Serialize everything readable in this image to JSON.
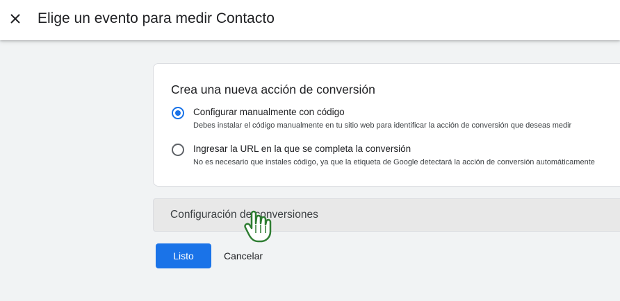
{
  "header": {
    "title": "Elige un evento para medir Contacto",
    "close_icon": "close-icon"
  },
  "card": {
    "title": "Crea una nueva acción de conversión",
    "options": [
      {
        "label": "Configurar manualmente con código",
        "description": "Debes instalar el código manualmente en tu sitio web para identificar la acción de conversión que deseas medir",
        "selected": true
      },
      {
        "label": "Ingresar la URL en la que se completa la conversión",
        "description": "No es necesario que instales código, ya que la etiqueta de Google detectará la acción de conversión automáticamente",
        "selected": false
      }
    ]
  },
  "accordion": {
    "label": "Configuración de conversiones"
  },
  "actions": {
    "done_label": "Listo",
    "cancel_label": "Cancelar"
  },
  "colors": {
    "accent": "#1a73e8",
    "background": "#f1f3f4",
    "cursor": "#34a853"
  }
}
